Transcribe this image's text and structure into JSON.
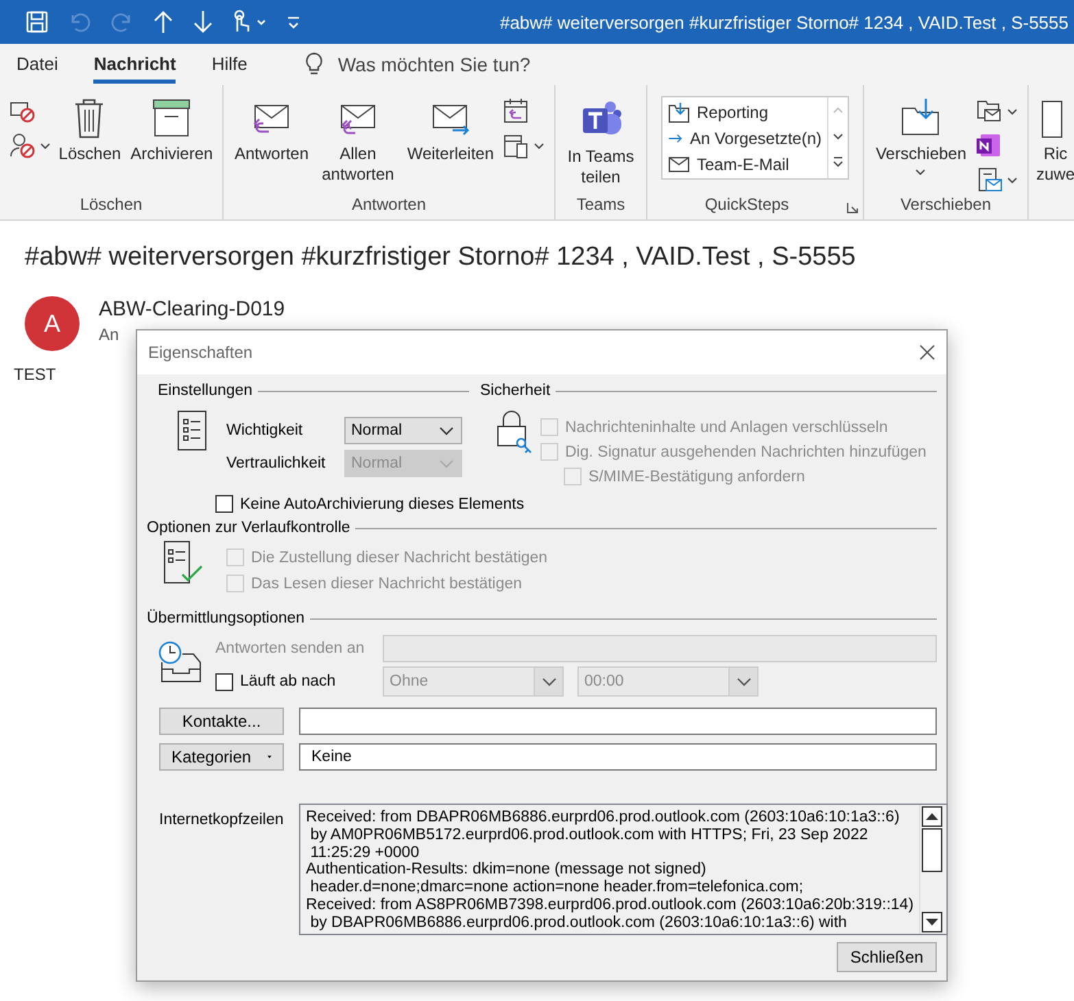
{
  "window": {
    "title": "#abw# weiterversorgen #kurzfristiger Storno# 1234 , VAID.Test , S-5555"
  },
  "quick_access": [
    {
      "kind": "save",
      "disabled": false
    },
    {
      "kind": "undo",
      "disabled": true
    },
    {
      "kind": "redo",
      "disabled": true
    },
    {
      "kind": "up",
      "disabled": false
    },
    {
      "kind": "down",
      "disabled": false
    },
    {
      "kind": "touch",
      "disabled": false
    },
    {
      "kind": "customize",
      "disabled": false
    }
  ],
  "menu_tabs": [
    {
      "label": "Datei",
      "selected": false
    },
    {
      "label": "Nachricht",
      "selected": true
    },
    {
      "label": "Hilfe",
      "selected": false
    }
  ],
  "search": {
    "placeholder": "Was möchten Sie tun?"
  },
  "ribbon": {
    "groups": [
      {
        "label": "Löschen",
        "items": [
          {
            "kind": "stack",
            "items": [
              {
                "menu": false
              },
              {
                "menu": true
              }
            ]
          },
          {
            "kind": "large",
            "label": "Löschen",
            "menu": false
          },
          {
            "kind": "large",
            "label": "Archivieren",
            "menu": false
          }
        ]
      },
      {
        "label": "Antworten",
        "items": [
          {
            "kind": "large",
            "label": "Antworten",
            "menu": false
          },
          {
            "kind": "large",
            "label": "Allen antworten",
            "menu": false
          },
          {
            "kind": "large",
            "label": "Weiterleiten",
            "menu": false
          },
          {
            "kind": "stack",
            "items": [
              {
                "menu": false
              },
              {
                "menu": true
              }
            ]
          }
        ]
      },
      {
        "label": "Teams",
        "items": [
          {
            "kind": "large",
            "label": "In Teams teilen",
            "menu": false
          }
        ]
      },
      {
        "label": "QuickSteps",
        "launcher": true,
        "items": [
          {
            "kind": "gallery",
            "entries": [
              {
                "label": "Reporting"
              },
              {
                "label": "An Vorgesetzte(n)"
              },
              {
                "label": "Team-E-Mail"
              }
            ]
          }
        ]
      },
      {
        "label": "Verschieben",
        "items": [
          {
            "kind": "large",
            "label": "Verschieben",
            "menu": true
          },
          {
            "kind": "stack",
            "items": [
              {
                "menu": true
              },
              {
                "menu": false
              },
              {
                "menu": true
              }
            ]
          }
        ]
      },
      {
        "items": [
          {
            "kind": "large",
            "label": "Ric\nzuwe",
            "menu": false
          }
        ]
      }
    ]
  },
  "message": {
    "subject": "#abw# weiterversorgen #kurzfristiger Storno# 1234 , VAID.Test , S-5555",
    "sender": {
      "initial": "A",
      "name": "ABW-Clearing-D019",
      "to_label": "An"
    },
    "body": "TEST"
  },
  "dialog": {
    "title": "Eigenschaften",
    "settings": {
      "heading": "Einstellungen",
      "importance": {
        "label": "Wichtigkeit",
        "value": "Normal",
        "disabled": false
      },
      "sensitivity": {
        "label": "Vertraulichkeit",
        "value": "Normal",
        "disabled": true
      },
      "no_autoarchive": {
        "label": "Keine AutoArchivierung dieses Elements",
        "checked": false,
        "disabled": false
      }
    },
    "security": {
      "heading": "Sicherheit",
      "options": [
        {
          "label": "Nachrichteninhalte und Anlagen verschlüsseln",
          "checked": false,
          "disabled": true
        },
        {
          "label": "Dig. Signatur ausgehenden Nachrichten hinzufügen",
          "checked": false,
          "disabled": true,
          "children": [
            {
              "label": "S/MIME-Bestätigung anfordern",
              "checked": false,
              "disabled": true
            }
          ]
        }
      ]
    },
    "tracking": {
      "heading": "Optionen zur Verlaufkontrolle",
      "options": [
        {
          "label": "Die Zustellung dieser Nachricht bestätigen",
          "checked": false,
          "disabled": true
        },
        {
          "label": "Das Lesen dieser Nachricht bestätigen",
          "checked": false,
          "disabled": true
        }
      ]
    },
    "delivery": {
      "heading": "Übermittlungsoptionen",
      "reply_to": {
        "label": "Antworten senden an",
        "disabled": true
      },
      "expires": {
        "label": "Läuft ab nach",
        "checked": false,
        "disabled": false,
        "date": "Ohne",
        "time": "00:00",
        "fields_disabled": true
      }
    },
    "contacts_button": "Kontakte...",
    "categories_button": "Kategorien",
    "categories_value": "Keine",
    "headers": {
      "label": "Internetkopfzeilen",
      "lines": [
        "Received: from DBAPR06MB6886.eurprd06.prod.outlook.com (2603:10a6:10:1a3::6)",
        " by AM0PR06MB5172.eurprd06.prod.outlook.com with HTTPS; Fri, 23 Sep 2022",
        " 11:25:29 +0000",
        "Authentication-Results: dkim=none (message not signed)",
        " header.d=none;dmarc=none action=none header.from=telefonica.com;",
        "Received: from AS8PR06MB7398.eurprd06.prod.outlook.com (2603:10a6:20b:319::14)",
        " by DBAPR06MB6886.eurprd06.prod.outlook.com (2603:10a6:10:1a3::6) with"
      ]
    },
    "close_button": "Schließen"
  }
}
